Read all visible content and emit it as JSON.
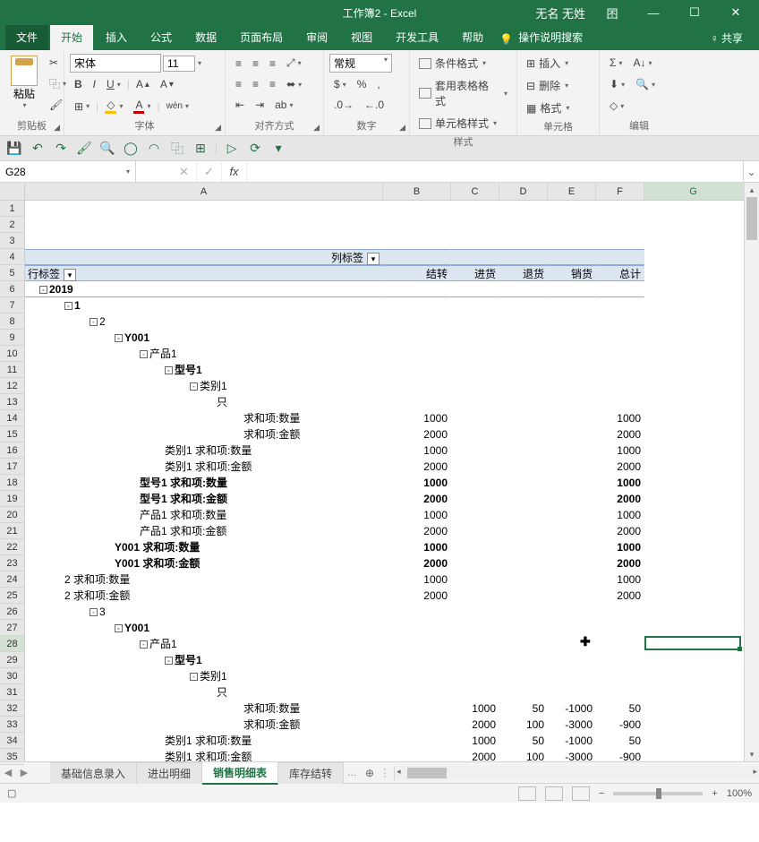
{
  "title": "工作簿2 - Excel",
  "user": "无名 无姓",
  "window_buttons": {
    "panel": "囨",
    "min": "—",
    "max": "☐",
    "close": "✕"
  },
  "tabs": {
    "file": "文件",
    "items": [
      "开始",
      "插入",
      "公式",
      "数据",
      "页面布局",
      "审阅",
      "视图",
      "开发工具",
      "帮助"
    ],
    "active": "开始",
    "tell_me": "操作说明搜索",
    "share": "共享"
  },
  "ribbon": {
    "clipboard": {
      "paste": "粘贴",
      "label": "剪贴板"
    },
    "font": {
      "name": "宋体",
      "size": "11",
      "label": "字体"
    },
    "align": {
      "label": "对齐方式"
    },
    "number": {
      "format": "常规",
      "label": "数字"
    },
    "styles": {
      "cond": "条件格式",
      "table": "套用表格格式",
      "cell": "单元格样式",
      "label": "样式"
    },
    "cells": {
      "insert": "插入",
      "delete": "删除",
      "format": "格式",
      "label": "单元格"
    },
    "editing": {
      "label": "编辑"
    }
  },
  "namebox": "G28",
  "columns": [
    "A",
    "B",
    "C",
    "D",
    "E",
    "F",
    "G"
  ],
  "pivot": {
    "col_label_header": "列标签",
    "row_label_header": "行标签",
    "col_headers": [
      "结转",
      "进货",
      "退货",
      "销货",
      "总计"
    ]
  },
  "rows": [
    {
      "n": 1
    },
    {
      "n": 2
    },
    {
      "n": 3
    },
    {
      "n": 4,
      "pvhdr": true,
      "a_extra": "col_label_title"
    },
    {
      "n": 5,
      "pvhdr": true,
      "a": "行标签",
      "a_dd": true,
      "b": "结转",
      "c": "进货",
      "d": "退货",
      "e": "销货",
      "f": "总计"
    },
    {
      "n": 6,
      "a": "2019",
      "bold": true,
      "indent": 1,
      "btn": "-",
      "pvline": true
    },
    {
      "n": 7,
      "a": "1",
      "bold": true,
      "indent": 2,
      "btn": "-"
    },
    {
      "n": 8,
      "a": "2",
      "indent": 3,
      "btn": "-"
    },
    {
      "n": 9,
      "a": "Y001",
      "bold": true,
      "indent": 4,
      "btn": "-"
    },
    {
      "n": 10,
      "a": "产品1",
      "indent": 5,
      "btn": "-"
    },
    {
      "n": 11,
      "a": "型号1",
      "bold": true,
      "indent": 6,
      "btn": "-"
    },
    {
      "n": 12,
      "a": "类别1",
      "indent": 7,
      "btn": "-"
    },
    {
      "n": 13,
      "a": "只",
      "indent": 8
    },
    {
      "n": 14,
      "a": "求和项:数量",
      "indent": 9,
      "b": "1000",
      "f": "1000"
    },
    {
      "n": 15,
      "a": "求和项:金额",
      "indent": 9,
      "b": "2000",
      "f": "2000"
    },
    {
      "n": 16,
      "a": "类别1 求和项:数量",
      "indent": 6,
      "b": "1000",
      "f": "1000"
    },
    {
      "n": 17,
      "a": "类别1 求和项:金额",
      "indent": 6,
      "b": "2000",
      "f": "2000"
    },
    {
      "n": 18,
      "a": "型号1 求和项:数量",
      "bold": true,
      "indent": 5,
      "b": "1000",
      "f": "1000"
    },
    {
      "n": 19,
      "a": "型号1 求和项:金额",
      "bold": true,
      "indent": 5,
      "b": "2000",
      "f": "2000"
    },
    {
      "n": 20,
      "a": "产品1 求和项:数量",
      "indent": 5,
      "b": "1000",
      "f": "1000"
    },
    {
      "n": 21,
      "a": "产品1 求和项:金额",
      "indent": 5,
      "b": "2000",
      "f": "2000"
    },
    {
      "n": 22,
      "a": "Y001 求和项:数量",
      "bold": true,
      "indent": 4,
      "b": "1000",
      "f": "1000"
    },
    {
      "n": 23,
      "a": "Y001 求和项:金额",
      "bold": true,
      "indent": 4,
      "b": "2000",
      "f": "2000"
    },
    {
      "n": 24,
      "a": "2 求和项:数量",
      "indent": 2,
      "b": "1000",
      "f": "1000"
    },
    {
      "n": 25,
      "a": "2 求和项:金额",
      "indent": 2,
      "b": "2000",
      "f": "2000"
    },
    {
      "n": 26,
      "a": "3",
      "indent": 3,
      "btn": "-"
    },
    {
      "n": 27,
      "a": "Y001",
      "bold": true,
      "indent": 4,
      "btn": "-"
    },
    {
      "n": 28,
      "a": "产品1",
      "indent": 5,
      "btn": "-",
      "hl": true,
      "cursor": true
    },
    {
      "n": 29,
      "a": "型号1",
      "bold": true,
      "indent": 6,
      "btn": "-"
    },
    {
      "n": 30,
      "a": "类别1",
      "indent": 7,
      "btn": "-"
    },
    {
      "n": 31,
      "a": "只",
      "indent": 8
    },
    {
      "n": 32,
      "a": "求和项:数量",
      "indent": 9,
      "c": "1000",
      "d": "50",
      "e": "-1000",
      "f": "50"
    },
    {
      "n": 33,
      "a": "求和项:金额",
      "indent": 9,
      "c": "2000",
      "d": "100",
      "e": "-3000",
      "f": "-900"
    },
    {
      "n": 34,
      "a": "类别1 求和项:数量",
      "indent": 6,
      "c": "1000",
      "d": "50",
      "e": "-1000",
      "f": "50"
    },
    {
      "n": 35,
      "a": "类别1 求和项:金额",
      "indent": 6,
      "c": "2000",
      "d": "100",
      "e": "-3000",
      "f": "-900"
    }
  ],
  "sheets": {
    "items": [
      "基础信息录入",
      "进出明细",
      "销售明细表",
      "库存结转"
    ],
    "active": "销售明细表"
  },
  "status": {
    "zoom": "100%"
  }
}
